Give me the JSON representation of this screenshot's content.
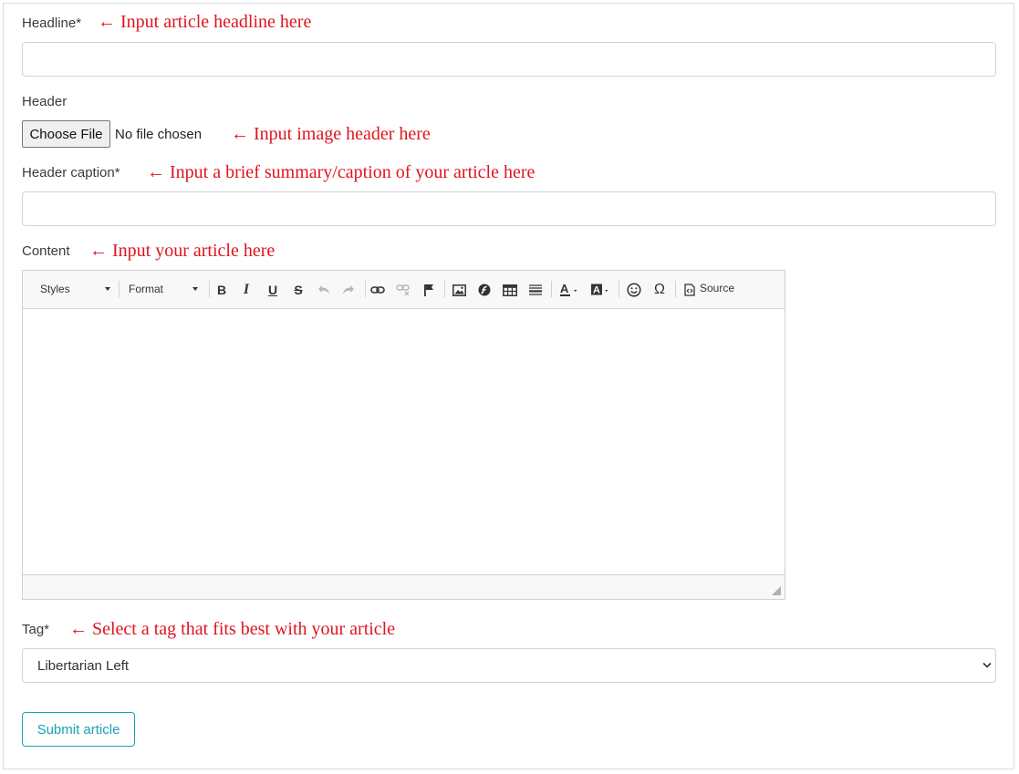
{
  "form": {
    "headline": {
      "label": "Headline*",
      "note": "← Input article headline here",
      "value": ""
    },
    "header": {
      "label": "Header",
      "button_label": "Choose File",
      "status": "No file chosen",
      "note": "← Input image header here"
    },
    "caption": {
      "label": "Header caption*",
      "note": "← Input a brief summary/caption of your article here",
      "value": ""
    },
    "content": {
      "label": "Content",
      "note": "← Input your article here",
      "toolbar": {
        "styles_label": "Styles",
        "format_label": "Format",
        "bold_glyph": "B",
        "italic_glyph": "I",
        "underline_glyph": "U",
        "strike_glyph": "S",
        "special_char_glyph": "Ω",
        "source_label": "Source",
        "icons": [
          "undo-icon",
          "redo-icon",
          "link-icon",
          "unlink-icon",
          "anchor-icon",
          "image-icon",
          "flash-icon",
          "table-icon",
          "horizontal-line-icon",
          "text-color-icon",
          "background-color-icon",
          "smiley-icon",
          "source-icon"
        ]
      }
    },
    "tag": {
      "label": "Tag*",
      "note": "← Select a tag that fits best with your article",
      "selected": "Libertarian Left"
    },
    "submit_label": "Submit article"
  }
}
